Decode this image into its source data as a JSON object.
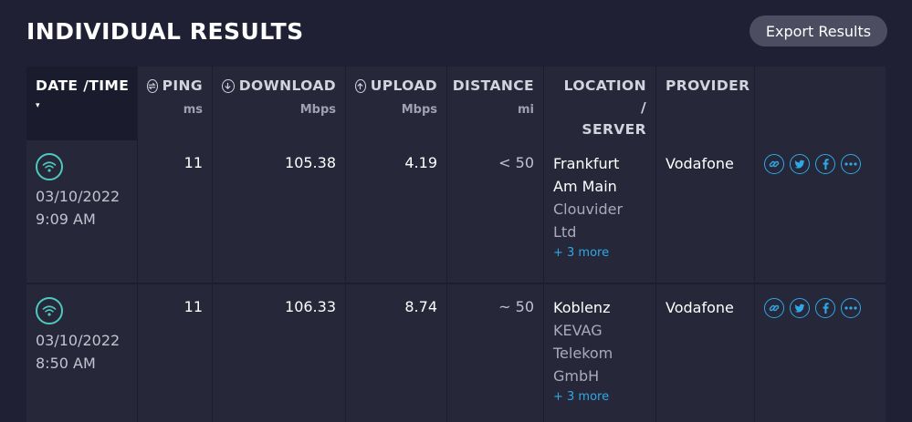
{
  "header": {
    "title": "INDIVIDUAL RESULTS",
    "export_label": "Export Results"
  },
  "columns": {
    "datetime": {
      "label": "DATE /TIME",
      "sort": "▾"
    },
    "ping": {
      "label": "PING",
      "unit": "ms",
      "icon": "ping-icon"
    },
    "download": {
      "label": "DOWNLOAD",
      "unit": "Mbps",
      "icon": "download-icon"
    },
    "upload": {
      "label": "UPLOAD",
      "unit": "Mbps",
      "icon": "upload-icon"
    },
    "distance": {
      "label": "DISTANCE",
      "unit": "mi"
    },
    "location": {
      "label_line1": "LOCATION /",
      "label_line2": "SERVER"
    },
    "provider": {
      "label": "PROVIDER"
    }
  },
  "rows": [
    {
      "date": "03/10/2022",
      "time": "9:09 AM",
      "connection_icon": "wifi-icon",
      "ping": "11",
      "download": "105.38",
      "upload": "4.19",
      "distance": "< 50",
      "location_line1": "Frankfurt",
      "location_line2": "Am Main",
      "server_line1": "Clouvider",
      "server_line2": "Ltd",
      "more": "+ 3 more",
      "provider": "Vodafone"
    },
    {
      "date": "03/10/2022",
      "time": "8:50 AM",
      "connection_icon": "wifi-icon",
      "ping": "11",
      "download": "106.33",
      "upload": "8.74",
      "distance": "~ 50",
      "location_line1": "Koblenz",
      "server_line1": "KEVAG",
      "server_line2": "Telekom",
      "server_line3": "GmbH",
      "more": "+ 3 more",
      "provider": "Vodafone"
    }
  ],
  "colors": {
    "background": "#1f2033",
    "cell": "#262739",
    "accent_link": "#2fa8e6",
    "wifi": "#4fc8c0",
    "button": "#4c4d60"
  },
  "share_icons": [
    "link-icon",
    "twitter-icon",
    "facebook-icon",
    "more-icon"
  ]
}
